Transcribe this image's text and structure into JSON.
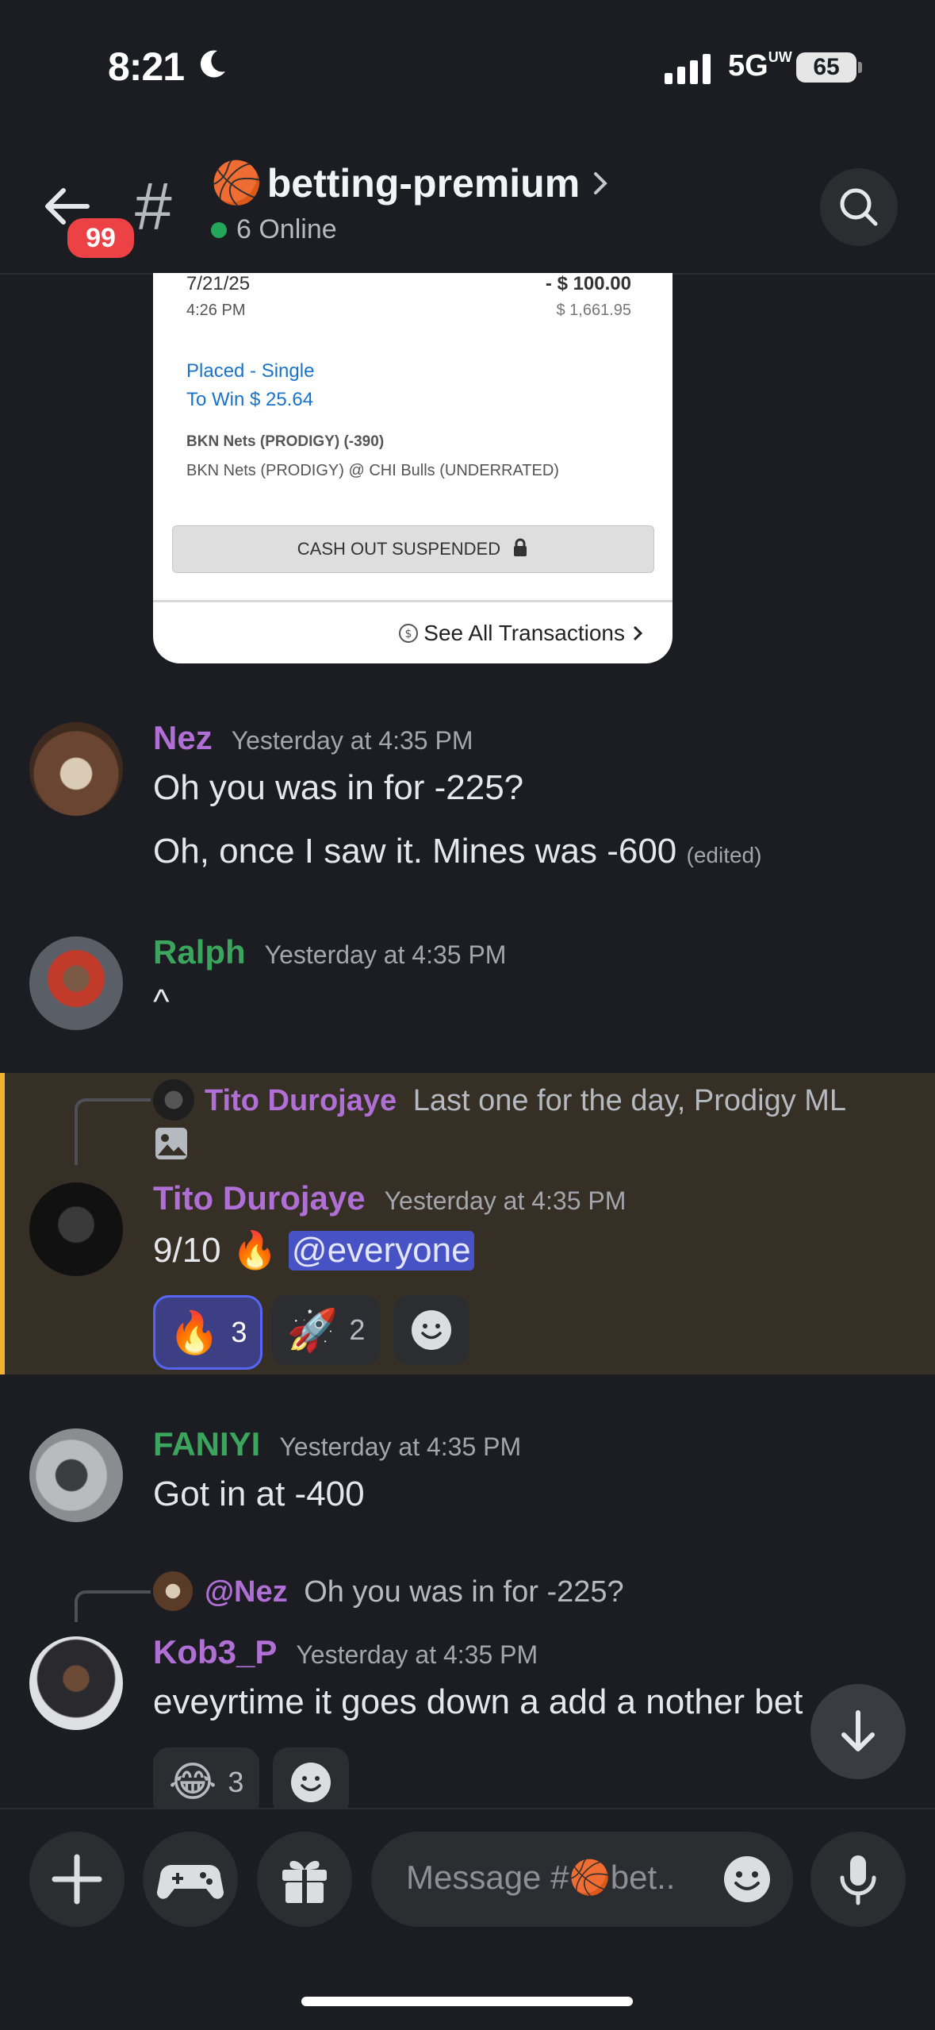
{
  "status": {
    "time": "8:21",
    "network": "5G",
    "network_sup": "UW",
    "battery": "65"
  },
  "header": {
    "unread_badge": "99",
    "channel_emoji": "🏀",
    "channel_name": "betting-premium",
    "online_text": "6 Online",
    "online_color": "#23a55a"
  },
  "bet_card": {
    "date": "7/21/25",
    "time": "4:26 PM",
    "amount": "- $ 100.00",
    "balance": "$ 1,661.95",
    "placed": "Placed - Single",
    "to_win": "To Win $ 25.64",
    "pick": "BKN Nets (PRODIGY) (-390)",
    "matchup": "BKN Nets (PRODIGY) @ CHI Bulls (UNDERRATED)",
    "cashout": "CASH OUT SUSPENDED",
    "see_all": "See All Transactions"
  },
  "messages": [
    {
      "user": "Nez",
      "color": "#b06fd4",
      "time": "Yesterday at 4:35 PM",
      "lines": [
        "Oh you was in for -225?",
        "Oh, once I saw it. Mines was -600"
      ],
      "edited": "(edited)"
    },
    {
      "user": "Ralph",
      "color": "#3ba55d",
      "time": "Yesterday at 4:35 PM",
      "lines": [
        "^"
      ]
    },
    {
      "user": "Tito Durojaye",
      "color": "#b06fd4",
      "time": "Yesterday at 4:35 PM",
      "reply_user": "Tito Durojaye",
      "reply_text": "Last one for the day, Prodigy ML",
      "text": "9/10",
      "emoji": "🔥",
      "mention": "@everyone",
      "reactions": [
        {
          "emoji": "🔥",
          "count": "3"
        },
        {
          "emoji": "🚀",
          "count": "2"
        }
      ]
    },
    {
      "user": "FANIYI",
      "color": "#3ba55d",
      "time": "Yesterday at 4:35 PM",
      "lines": [
        "Got in at -400"
      ]
    },
    {
      "user": "Kob3_P",
      "color": "#b06fd4",
      "time": "Yesterday at 4:35 PM",
      "reply_user": "@Nez",
      "reply_text": "Oh you was in for -225?",
      "lines": [
        "eveyrtime it goes down a add a nother bet"
      ],
      "reactions": [
        {
          "emoji": "😂",
          "count": "3"
        }
      ]
    }
  ],
  "composer": {
    "placeholder": "Message #🏀bet.."
  },
  "icons": [
    "moon-icon",
    "back-arrow-icon",
    "hash-icon",
    "search-icon",
    "chevron-right-icon",
    "lock-icon",
    "info-icon",
    "image-icon",
    "add-reaction-icon",
    "arrow-down-icon",
    "plus-icon",
    "gamepad-icon",
    "gift-icon",
    "emoji-icon",
    "microphone-icon"
  ]
}
